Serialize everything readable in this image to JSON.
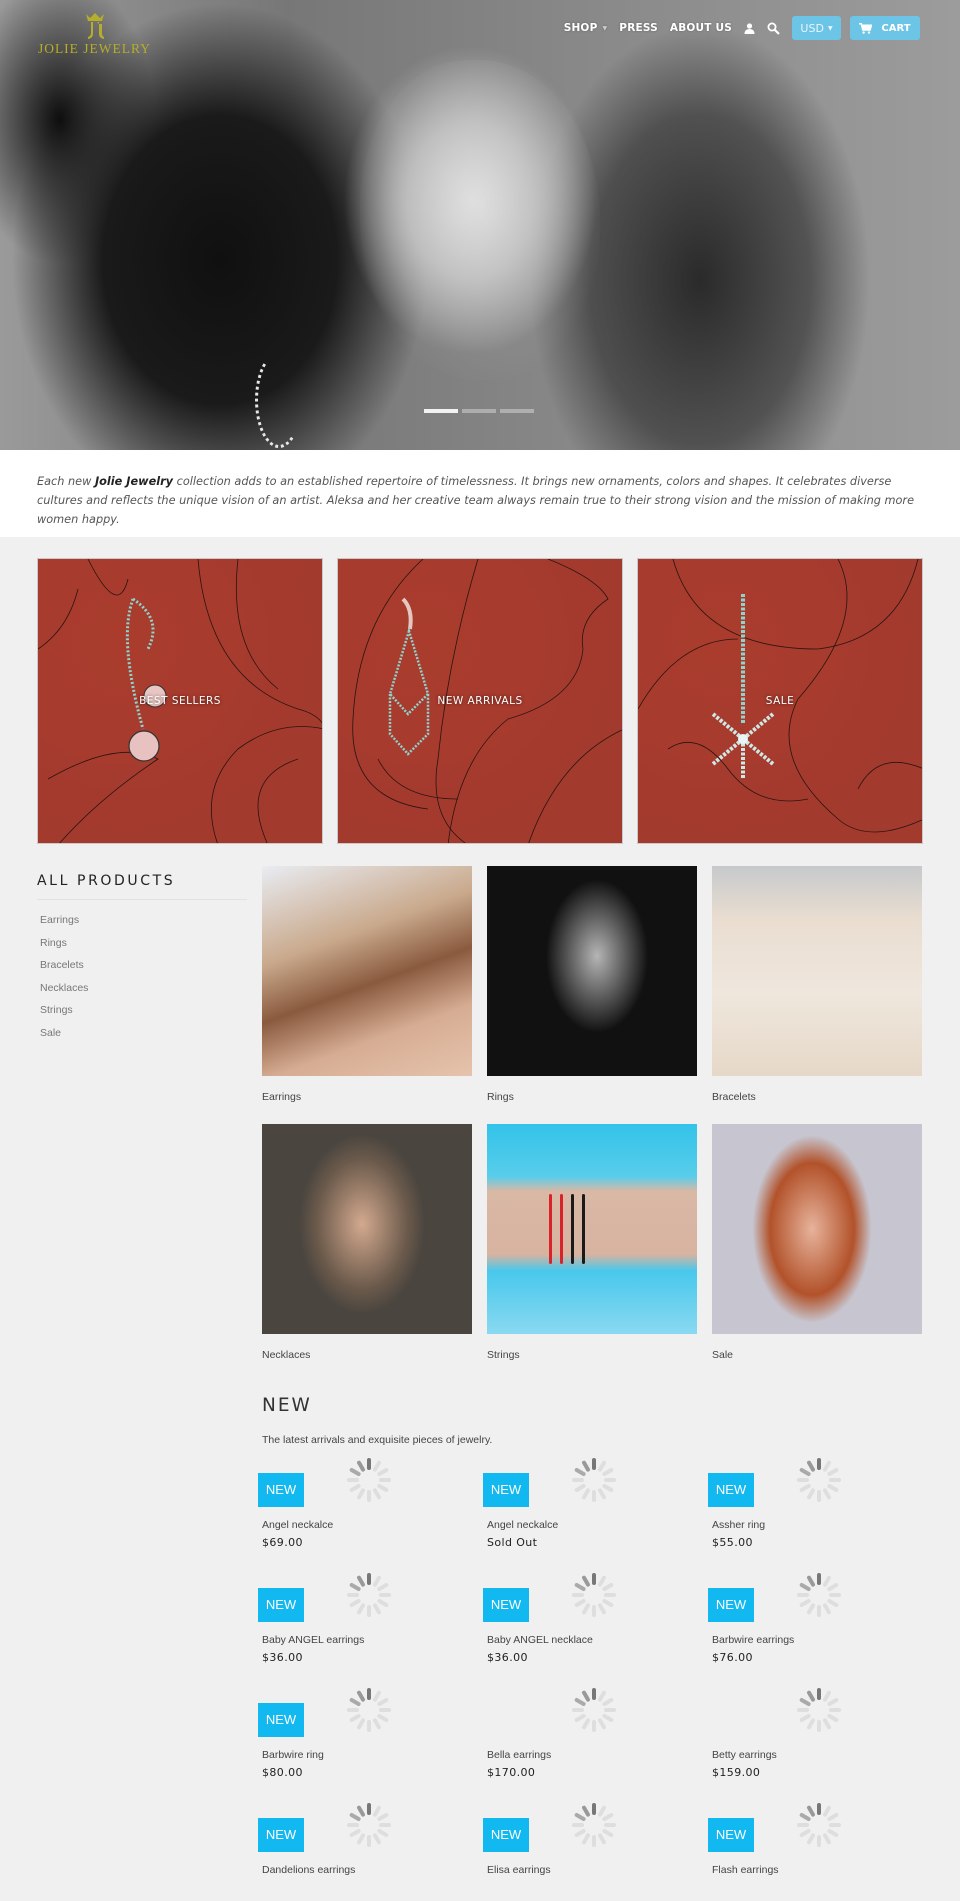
{
  "brand": {
    "name": "JOLIE JEWELRY",
    "logo_icon": "crown-monogram-icon",
    "color": "#b6ad2a"
  },
  "nav": {
    "items": [
      {
        "label": "SHOP",
        "has_dropdown": true
      },
      {
        "label": "PRESS"
      },
      {
        "label": "ABOUT US"
      }
    ],
    "account_icon": "user-icon",
    "search_icon": "search-icon",
    "currency": {
      "selected": "USD"
    },
    "cart_label": "CART",
    "cart_icon": "cart-icon",
    "accent_color": "#6cc4e6"
  },
  "hero": {
    "slides_total": 3,
    "active_slide": 1
  },
  "intro": {
    "prefix": "Each new ",
    "brand_emphasis": "Jolie Jewelry",
    "suffix": " collection adds to an established repertoire of timelessness. It brings new ornaments, colors and shapes. It celebrates diverse cultures and reflects the unique vision of an artist. Aleksa and her creative team always remain true to their strong vision and the mission of making more women happy."
  },
  "collections": [
    {
      "label": "BEST SELLERS"
    },
    {
      "label": "NEW ARRIVALS"
    },
    {
      "label": "SALE"
    }
  ],
  "sidebar": {
    "title": "ALL PRODUCTS",
    "items": [
      "Earrings",
      "Rings",
      "Bracelets",
      "Necklaces",
      "Strings",
      "Sale"
    ]
  },
  "categories": [
    {
      "name": "Earrings"
    },
    {
      "name": "Rings"
    },
    {
      "name": "Bracelets"
    },
    {
      "name": "Necklaces"
    },
    {
      "name": "Strings"
    },
    {
      "name": "Sale"
    }
  ],
  "new_section": {
    "title": "NEW",
    "subtitle": "The latest arrivals and exquisite pieces of jewelry.",
    "badge_label": "NEW",
    "badge_color": "#12b8f0",
    "products": [
      {
        "name": "Angel neckalce",
        "price": "$69.00",
        "is_new": true
      },
      {
        "name": "Angel neckalce",
        "price": "Sold Out",
        "is_new": true
      },
      {
        "name": "Assher ring",
        "price": "$55.00",
        "is_new": true
      },
      {
        "name": "Baby ANGEL earrings",
        "price": "$36.00",
        "is_new": true
      },
      {
        "name": "Baby ANGEL necklace",
        "price": "$36.00",
        "is_new": true
      },
      {
        "name": "Barbwire earrings",
        "price": "$76.00",
        "is_new": true
      },
      {
        "name": "Barbwire ring",
        "price": "$80.00",
        "is_new": true
      },
      {
        "name": "Bella earrings",
        "price": "$170.00",
        "is_new": false
      },
      {
        "name": "Betty earrings",
        "price": "$159.00",
        "is_new": false
      },
      {
        "name": "Dandelions earrings",
        "price": "",
        "is_new": true
      },
      {
        "name": "Elisa earrings",
        "price": "",
        "is_new": true
      },
      {
        "name": "Flash earrings",
        "price": "",
        "is_new": true
      }
    ]
  }
}
